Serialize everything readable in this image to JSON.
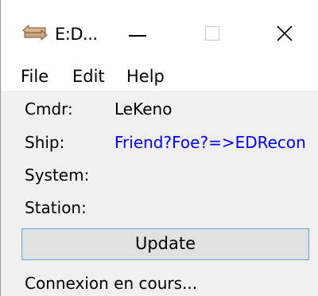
{
  "window": {
    "title": "E:D...",
    "app_icon": "arrows-swap-icon",
    "controls": {
      "minimize_icon": "minimize-icon",
      "maximize_icon": "maximize-icon",
      "close_icon": "close-icon"
    }
  },
  "menu": {
    "file": "File",
    "edit": "Edit",
    "help": "Help"
  },
  "info": {
    "cmdr_label": "Cmdr:",
    "cmdr_value": "LeKeno",
    "ship_label": "Ship:",
    "ship_value": "Friend?Foe?=>EDRecon",
    "system_label": "System:",
    "station_label": "Station:"
  },
  "update_button_label": "Update",
  "status": "Connexion en cours...",
  "colors": {
    "link": "#0000ff",
    "icon": "#c9a47e",
    "button_border": "#7a9dc2"
  }
}
